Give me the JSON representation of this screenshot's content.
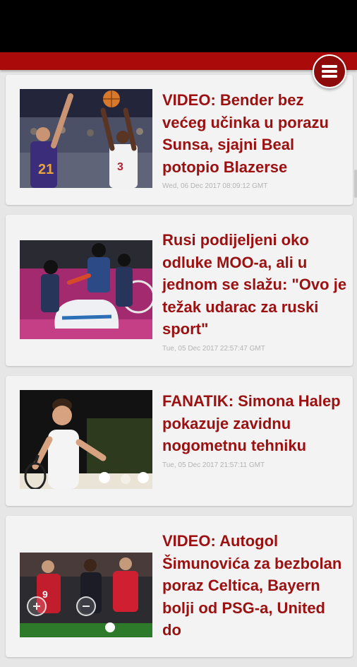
{
  "app": {
    "accent": "#ab0a0a",
    "headline_color": "#9b1111",
    "menu_icon": "hamburger-menu-icon"
  },
  "articles": [
    {
      "headline": "VIDEO: Bender bez većeg učinka u porazu Sunsa, sjajni Beal potopio Blazerse",
      "timestamp": "Wed, 06 Dec 2017 08:09:12 GMT",
      "image": "basketball-photo"
    },
    {
      "headline": "Rusi podijeljeni oko odluke MOO-a, ali u jednom se slažu: \"Ovo je težak udarac za ruski sport\"",
      "timestamp": "Tue, 05 Dec 2017 22:57:47 GMT",
      "image": "bobsleigh-photo"
    },
    {
      "headline": "FANATIK: Simona Halep pokazuje zavidnu nogometnu tehniku",
      "timestamp": "Tue, 05 Dec 2017 21:57:11 GMT",
      "image": "tennis-photo"
    },
    {
      "headline": "VIDEO: Autogol Šimunovića za bezbolan poraz Celtica, Bayern bolji od PSG-a, United do",
      "timestamp": "",
      "image": "football-photo"
    }
  ]
}
